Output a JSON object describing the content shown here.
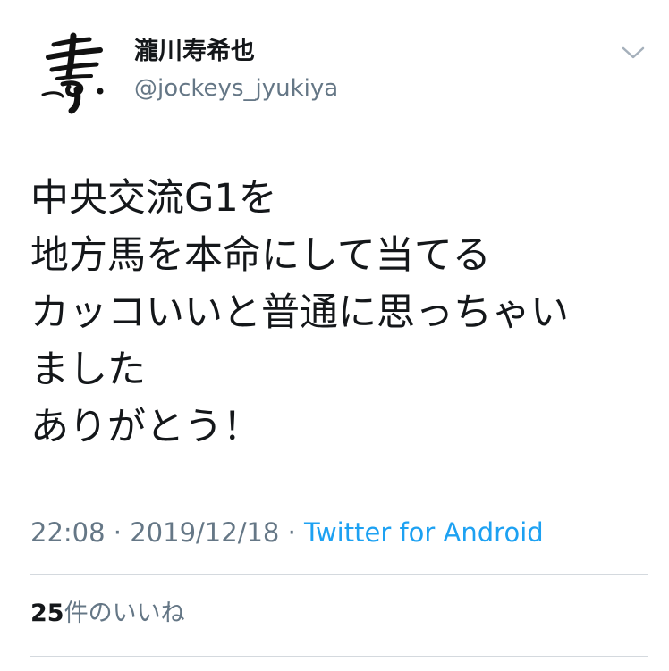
{
  "author": {
    "display_name": "瀧川寿希也",
    "handle": "@jockeys_jyukiya",
    "avatar_glyph": "壽"
  },
  "tweet": {
    "lines": [
      "中央交流G1を",
      "地方馬を本命にして当てる",
      "カッコいいと普通に思っちゃい",
      "ました",
      "ありがとう！"
    ]
  },
  "meta": {
    "time": "22:08",
    "separator": "·",
    "date": "2019/12/18",
    "source": "Twitter for Android"
  },
  "stats": {
    "likes_count": "25",
    "likes_label": "件のいいね"
  },
  "icons": {
    "menu": "chevron-down-icon",
    "avatar": "calligraphy-avatar-icon"
  },
  "colors": {
    "text": "#14171a",
    "secondary": "#657786",
    "link": "#1da1f2",
    "divider": "#d4d9de"
  }
}
